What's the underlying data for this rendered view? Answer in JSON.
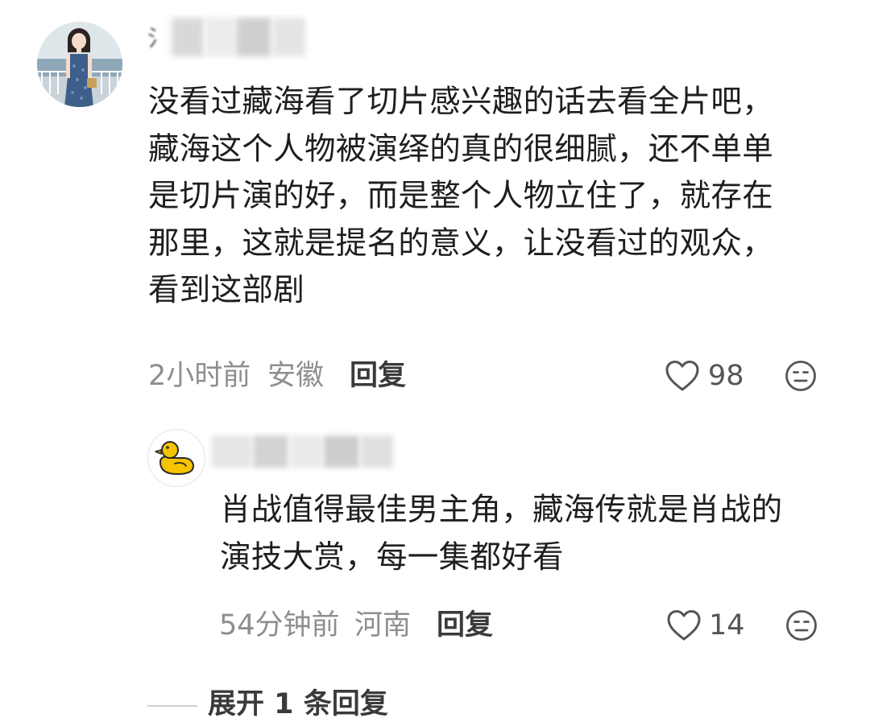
{
  "comment": {
    "text": "没看过藏海看了切片感兴趣的话去看全片吧，\n藏海这个人物被演绎的真的很细腻，还不单单\n是切片演的好，而是整个人物立住了，就存在\n那里，这就是提名的意义，让没看过的观众，\n看到这部剧",
    "time": "2小时前",
    "location": "安徽",
    "reply_label": "回复",
    "like_count": "98"
  },
  "reply": {
    "text": "肖战值得最佳男主角，藏海传就是肖战的\n演技大赏，每一集都好看",
    "time": "54分钟前",
    "location": "河南",
    "reply_label": "回复",
    "like_count": "14"
  },
  "expand": {
    "label": "展开 1 条回复"
  },
  "icons": {
    "like": "heart-outline-icon",
    "more": "emoji-face-icon",
    "avatar_reply": "yellow-duck-icon"
  },
  "colors": {
    "meta_gray": "#8e8e8e",
    "duck_yellow": "#F5C400"
  }
}
